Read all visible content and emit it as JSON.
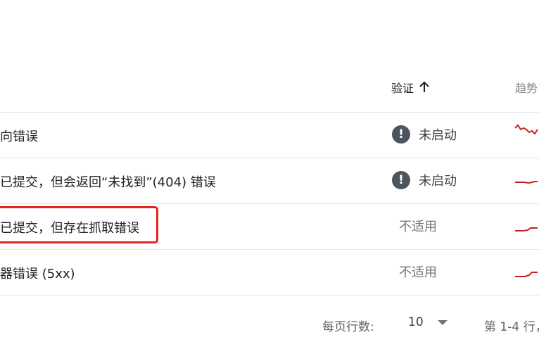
{
  "table": {
    "header": {
      "verify_label": "验证",
      "sort_icon": "arrow-up-icon",
      "trend_label": "趋势"
    },
    "rows": [
      {
        "issue": "向错误",
        "status": "未启动",
        "status_type": "warning"
      },
      {
        "issue": "已提交，但会返回“未找到”(404) 错误",
        "status": "未启动",
        "status_type": "warning"
      },
      {
        "issue": "已提交，但存在抓取错误",
        "status": "不适用",
        "status_type": "na"
      },
      {
        "issue": "器错误 (5xx)",
        "status": "不适用",
        "status_type": "na"
      }
    ]
  },
  "footer": {
    "rows_per_page_label": "每页行数:",
    "rows_per_page_value": "10",
    "range": "第 1-4 行，"
  },
  "colors": {
    "sparkline": "#c5221f",
    "highlight": "#e5261f",
    "warning_icon_bg": "#4a5560"
  }
}
